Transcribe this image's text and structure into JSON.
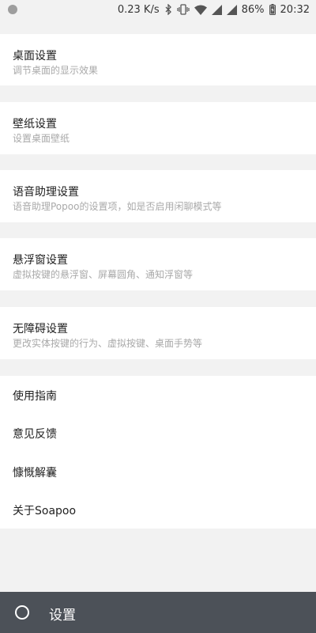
{
  "status_bar": {
    "net_speed": "0.23 K/s",
    "battery": "86%",
    "time": "20:32",
    "icons": [
      "notification-dot-icon",
      "bluetooth-icon",
      "vibrate-icon",
      "wifi-icon",
      "signal-icon",
      "signal-icon-2",
      "battery-charging-icon"
    ]
  },
  "settings_cards": [
    {
      "title": "桌面设置",
      "subtitle": "调节桌面的显示效果"
    },
    {
      "title": "壁纸设置",
      "subtitle": "设置桌面壁纸"
    },
    {
      "title": "语音助理设置",
      "subtitle": "语音助理Popoo的设置项，如是否启用闲聊模式等"
    },
    {
      "title": "悬浮窗设置",
      "subtitle": "虚拟按键的悬浮窗、屏幕圆角、通知浮窗等"
    },
    {
      "title": "无障碍设置",
      "subtitle": "更改实体按键的行为、虚拟按键、桌面手势等"
    }
  ],
  "menu_items": [
    "使用指南",
    "意见反馈",
    "慷慨解囊",
    "关于Soapoo"
  ],
  "bottom_bar": {
    "title": "设置"
  },
  "colors": {
    "background": "#f2f2f2",
    "card": "#ffffff",
    "title_text": "#212121",
    "subtitle_text": "#a9a9a9",
    "bottom_bar": "#4c5158"
  }
}
